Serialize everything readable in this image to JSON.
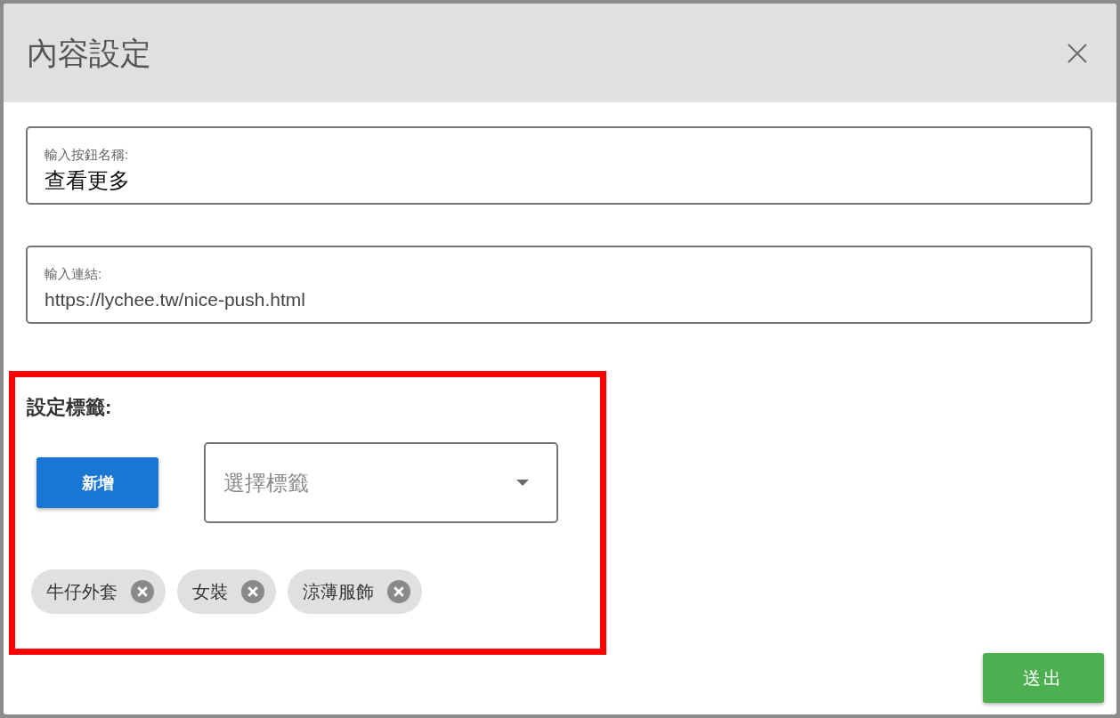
{
  "dialog": {
    "title": "內容設定"
  },
  "fields": [
    {
      "kind": "text",
      "label": "輸入按鈕名稱:",
      "value": "查看更多"
    },
    {
      "kind": "url",
      "label": "輸入連結:",
      "value": "https://lychee.tw/nice-push.html"
    }
  ],
  "tag_section": {
    "highlighted": true,
    "title": "設定標籤:",
    "add_button": "新增",
    "tag_select": {
      "placeholder": "選擇標籤"
    },
    "tags": [
      {
        "label": "牛仔外套"
      },
      {
        "label": "女裝"
      },
      {
        "label": "涼薄服飾"
      }
    ]
  },
  "submit_button": "送出"
}
